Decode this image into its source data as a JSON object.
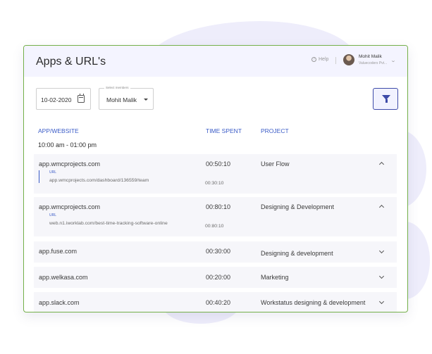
{
  "header": {
    "title": "Apps & URL's",
    "help_label": "Help",
    "user_name": "Mohit Malik",
    "user_company": "Valuecoders Pvt..."
  },
  "filters": {
    "date": "10-02-2020",
    "members_label": "Select members",
    "members_value": "Mohit Malik"
  },
  "table": {
    "columns": [
      "APP/WEBSITE",
      "TIME SPENT",
      "PROJECT"
    ],
    "time_slot": "10:00 am - 01:00 pm",
    "url_label": "URL",
    "rows": [
      {
        "app": "app.wmcprojects.com",
        "time": "00:50:10",
        "project": "User Flow",
        "expanded": true,
        "url": "app.wmcprojects.com/dashboard/136559/team",
        "url_time": "00:30:10"
      },
      {
        "app": "app.wmcprojects.com",
        "time": "00:80:10",
        "project": "Designing & Development",
        "expanded": true,
        "url": "web.n1.iworklab.com/best-time-tracking-software-online",
        "url_time": "00:80:10"
      },
      {
        "app": "app.fuse.com",
        "time": "00:30:00",
        "project": "Designing & development",
        "expanded": false
      },
      {
        "app": "app.welkasa.com",
        "time": "00:20:00",
        "project": "Marketing",
        "expanded": false
      },
      {
        "app": "app.slack.com",
        "time": "00:40:20",
        "project": "Workstatus designing & development",
        "expanded": false
      }
    ]
  },
  "colors": {
    "accent": "#3a5bc7",
    "card_border": "#74b04a",
    "header_bg": "#f4f4ff",
    "row_bg": "#f6f6fa"
  }
}
